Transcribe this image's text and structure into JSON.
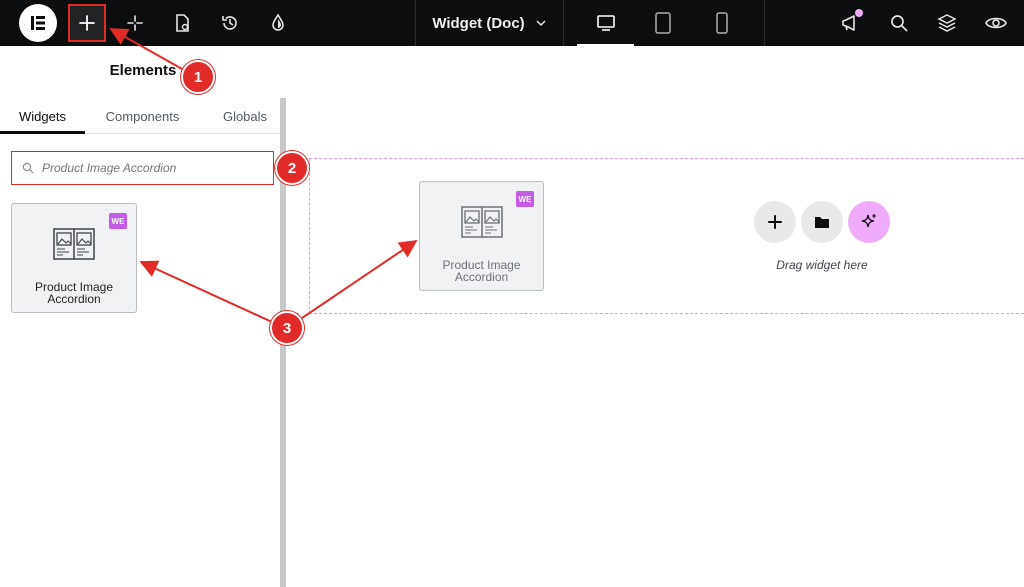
{
  "topbar": {
    "document_title": "Widget (Doc)",
    "icons": [
      "elementor-logo-icon",
      "plus-icon",
      "ai-sparkle-icon",
      "page-settings-icon",
      "history-icon",
      "color-drop-icon",
      "chevron-down-icon",
      "desktop-icon",
      "tablet-icon",
      "mobile-icon",
      "megaphone-icon",
      "search-icon",
      "layers-icon",
      "eye-icon"
    ],
    "notification_color": "#f0abfc"
  },
  "panel": {
    "title": "Elements",
    "tabs": [
      {
        "label": "Widgets",
        "active": true
      },
      {
        "label": "Components",
        "active": false
      },
      {
        "label": "Globals",
        "active": false
      }
    ],
    "search": {
      "placeholder": "Product Image Accordion",
      "value": ""
    },
    "widget": {
      "label_line1": "Product Image",
      "label_line2": "Accordion",
      "badge": "WE"
    }
  },
  "canvas": {
    "dragged_widget": {
      "label_line1": "Product Image",
      "label_line2": "Accordion",
      "badge": "WE"
    },
    "drop_hint": "Drag widget here",
    "buttons": [
      "add-section",
      "template-library",
      "ai-generate"
    ]
  },
  "annotations": {
    "callouts": [
      "1",
      "2",
      "3"
    ],
    "color": "#e02b27"
  },
  "colors": {
    "accent": "#e02b27",
    "badge": "#c45ce6",
    "dashed_border": "#e09ae8",
    "ai_button": "#f0abfc"
  }
}
